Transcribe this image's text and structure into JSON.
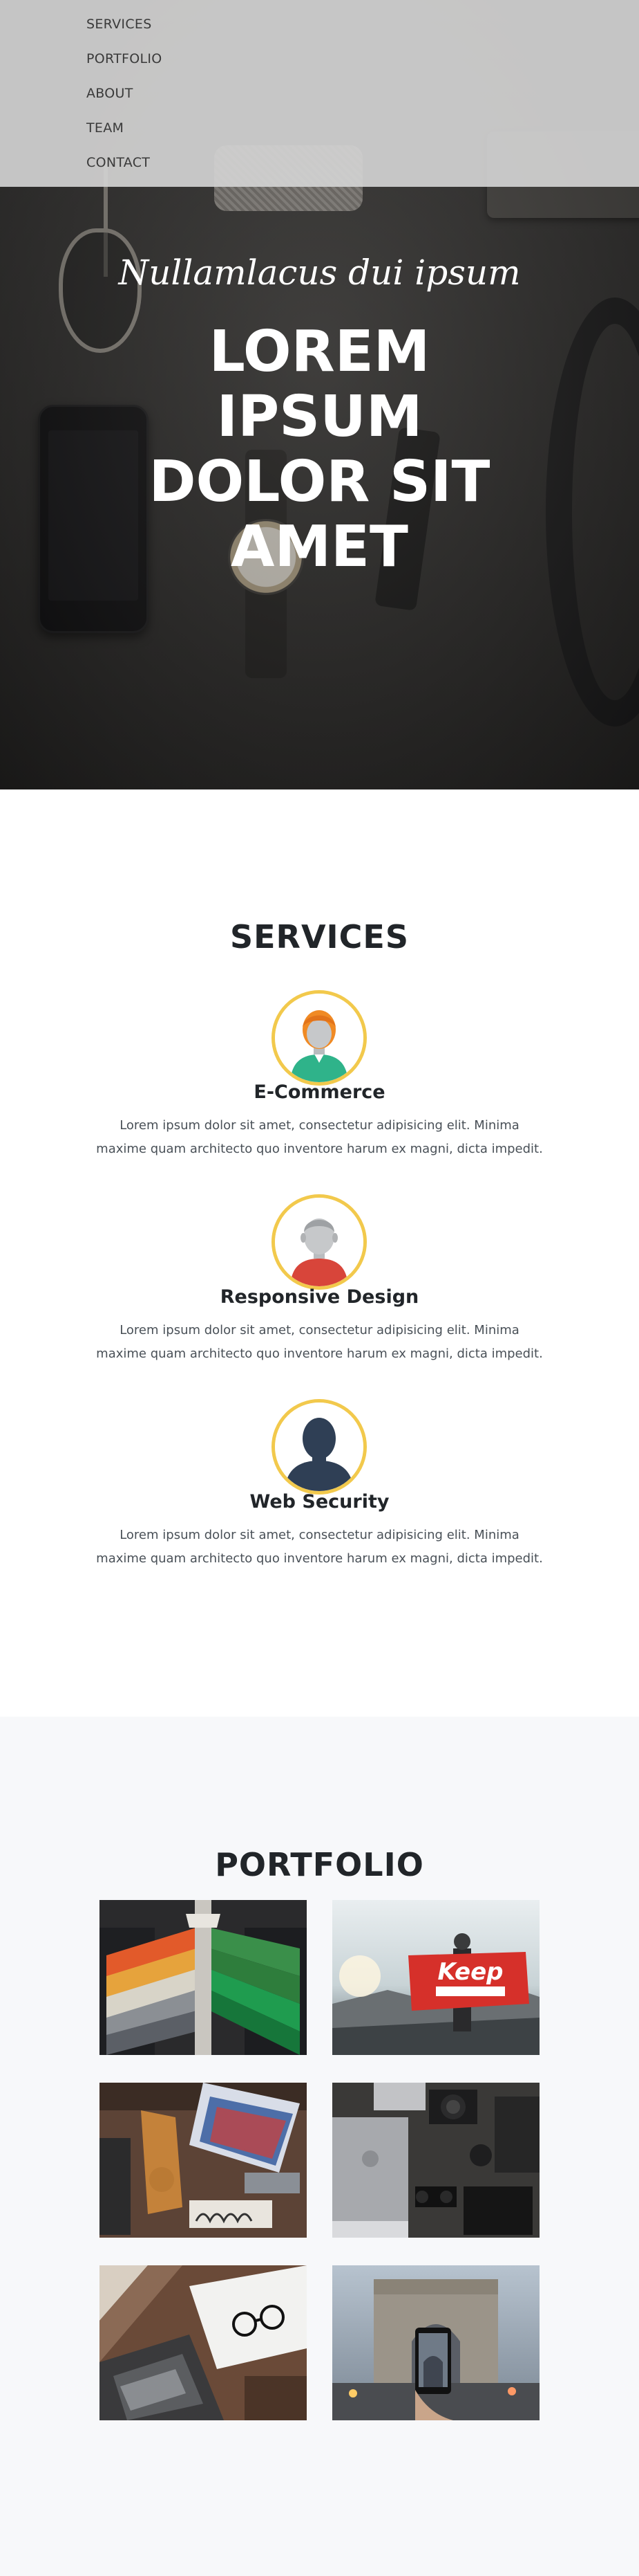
{
  "nav": {
    "items": [
      {
        "label": "SERVICES"
      },
      {
        "label": "PORTFOLIO"
      },
      {
        "label": "ABOUT"
      },
      {
        "label": "TEAM"
      },
      {
        "label": "CONTACT"
      }
    ]
  },
  "hero": {
    "subtitle": "Nullamlacus dui ipsum",
    "title_lines": [
      "LOREM",
      "IPSUM",
      "DOLOR SIT",
      "AMET"
    ]
  },
  "services": {
    "title": "SERVICES",
    "items": [
      {
        "name": "E-Commerce",
        "icon": "avatar-orange-hair-icon",
        "desc_1": "Lorem ipsum dolor sit amet, consectetur adipisicing elit. Minima",
        "desc_2": "maxime quam architecto quo inventore harum ex magni, dicta impedit."
      },
      {
        "name": "Responsive Design",
        "icon": "avatar-gray-hair-icon",
        "desc_1": "Lorem ipsum dolor sit amet, consectetur adipisicing elit. Minima",
        "desc_2": "maxime quam architecto quo inventore harum ex magni, dicta impedit."
      },
      {
        "name": "Web Security",
        "icon": "avatar-silhouette-icon",
        "desc_1": "Lorem ipsum dolor sit amet, consectetur adipisicing elit. Minima",
        "desc_2": "maxime quam architecto quo inventore harum ex magni, dicta impedit."
      }
    ],
    "accent_color": "#f2c94c"
  },
  "portfolio": {
    "title": "PORTFOLIO",
    "images": [
      {
        "name": "shirts-on-hangers-image"
      },
      {
        "name": "keep-exploring-flag-image"
      },
      {
        "name": "desk-flatlay-image"
      },
      {
        "name": "laptop-camera-flatlay-image"
      },
      {
        "name": "laptop-glasses-desk-image"
      },
      {
        "name": "arc-de-triomphe-phone-image"
      }
    ]
  }
}
